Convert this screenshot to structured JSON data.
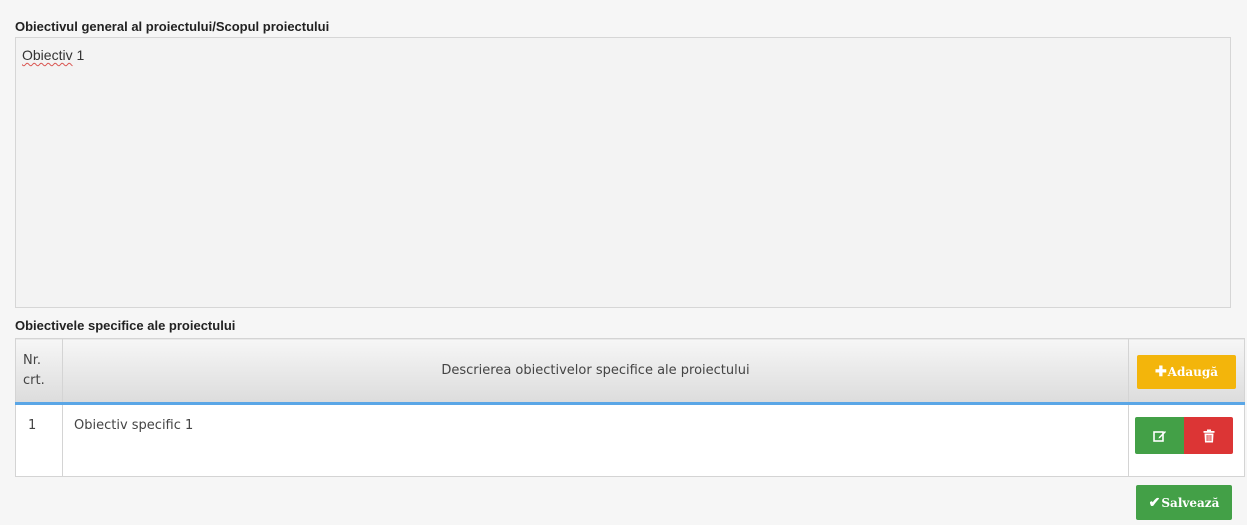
{
  "general": {
    "label": "Obiectivul general al proiectului/Scopul proiectului",
    "value_word": "Obiectiv",
    "value_rest": " 1"
  },
  "specific": {
    "label": "Obiectivele specifice ale proiectului",
    "columns": {
      "nr_line1": "Nr.",
      "nr_line2": "crt.",
      "description": "Descrierea obiectivelor specifice ale proiectului"
    },
    "add_label": "Adaugă",
    "rows": [
      {
        "nr": "1",
        "description": "Obiectiv specific 1"
      }
    ]
  },
  "icons": {
    "add": "plus-icon",
    "edit": "edit-icon",
    "delete": "trash-icon",
    "save": "check-icon"
  },
  "save_label": "Salvează",
  "colors": {
    "add": "#f3b50b",
    "edit": "#43a047",
    "delete": "#dc3535",
    "header_underline": "#5aa6e6"
  }
}
